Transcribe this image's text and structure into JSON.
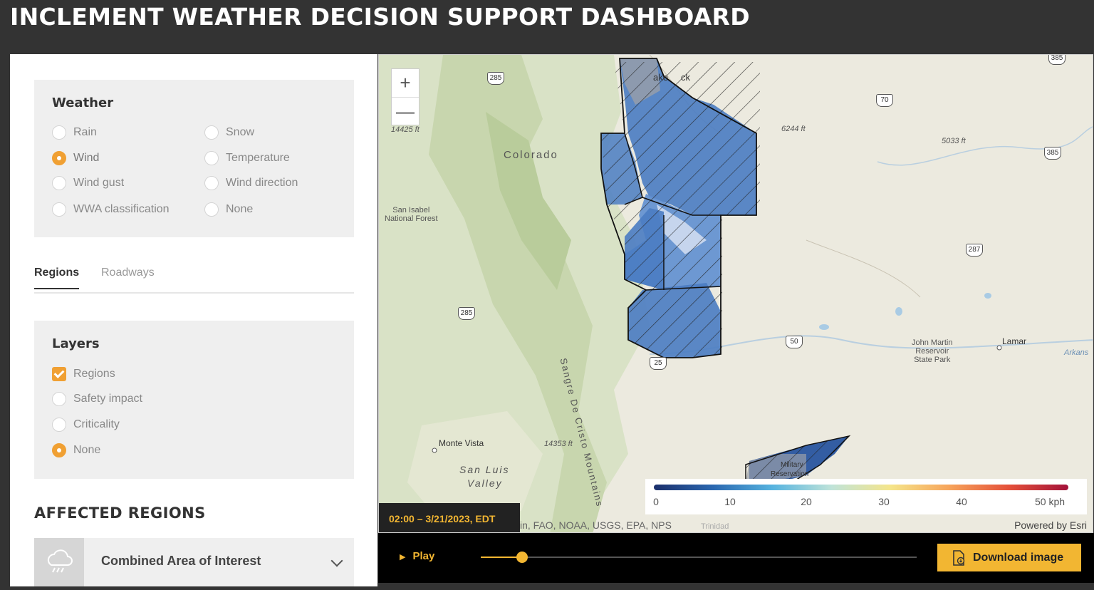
{
  "header": {
    "title": "INCLEMENT WEATHER DECISION SUPPORT DASHBOARD"
  },
  "weather": {
    "title": "Weather",
    "options": [
      {
        "label": "Rain",
        "selected": false
      },
      {
        "label": "Snow",
        "selected": false
      },
      {
        "label": "Wind",
        "selected": true
      },
      {
        "label": "Temperature",
        "selected": false
      },
      {
        "label": "Wind gust",
        "selected": false
      },
      {
        "label": "Wind direction",
        "selected": false
      },
      {
        "label": "WWA classification",
        "selected": false
      },
      {
        "label": "None",
        "selected": false
      }
    ]
  },
  "tabs": {
    "regions": "Regions",
    "roadways": "Roadways"
  },
  "layers": {
    "title": "Layers",
    "options": [
      {
        "label": "Regions",
        "checked": true
      },
      {
        "label": "Safety impact",
        "checked": false
      },
      {
        "label": "Criticality",
        "checked": false
      },
      {
        "label": "None",
        "checked": true
      }
    ]
  },
  "affected": {
    "title": "AFFECTED REGIONS",
    "item": "Combined Area of Interest"
  },
  "map": {
    "zoom_in": "+",
    "zoom_out": "—",
    "labels": {
      "colorado": "Colorado",
      "san_isabel": "San Isabel",
      "national_forest": "National Forest",
      "monte_vista": "Monte Vista",
      "san_luis": "San Luis",
      "valley": "Valley",
      "sangre": "Sangre De Cristo Mountains",
      "john_martin": "John Martin",
      "reservoir": "Reservoir",
      "state_park": "State Park",
      "lamar": "Lamar",
      "arkansas": "Arkans",
      "trinidad": "Trinidad",
      "military": "Military",
      "reservation": "Reservation",
      "lake": "ake",
      "rock": "ck"
    },
    "elevations": [
      "14425 ft",
      "6244 ft",
      "5033 ft",
      "14353 ft"
    ],
    "shields": [
      "285",
      "70",
      "385",
      "385",
      "287",
      "285",
      "50",
      "25"
    ],
    "legend": {
      "ticks": [
        "0",
        "10",
        "20",
        "30",
        "40",
        "50 kph"
      ],
      "unit": "kph"
    },
    "timestamp": "02:00  – 3/21/2023, EDT",
    "attribution": "in, FAO, NOAA, USGS, EPA, NPS",
    "powered": "Powered by Esri",
    "colors": {
      "accent": "#f2b632",
      "region_fill": "#4a7cc2",
      "region_dark": "#1f4e9c"
    }
  },
  "player": {
    "play_label": "Play",
    "progress": 0.095,
    "download_label": "Download image"
  }
}
